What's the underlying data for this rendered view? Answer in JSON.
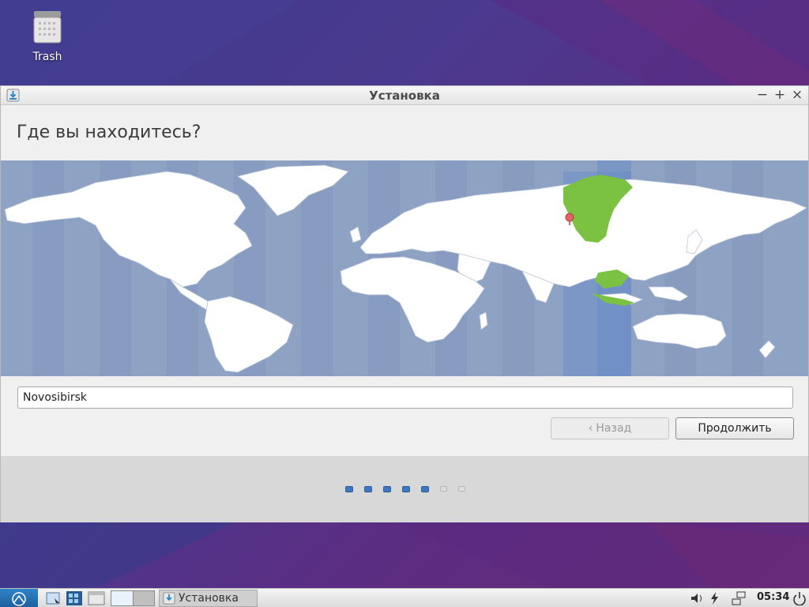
{
  "desktop": {
    "icons": [
      {
        "label": "Trash",
        "icon": "trash-icon"
      }
    ]
  },
  "window": {
    "title": "Установка",
    "controls": [
      "minimize",
      "maximize",
      "close"
    ]
  },
  "page": {
    "heading": "Где вы находитесь?",
    "timezone_map": {
      "selected_city": "Novosibirsk",
      "selected_color": "#7cc242",
      "highlight_band_color": "#6a8ec6"
    },
    "city_field": {
      "value": "Novosibirsk"
    },
    "buttons": {
      "back": "Назад",
      "next": "Продолжить"
    },
    "progress": {
      "total_steps": 7,
      "current_step": 5
    }
  },
  "taskbar": {
    "task_label": "Установка",
    "clock": "05:34"
  }
}
